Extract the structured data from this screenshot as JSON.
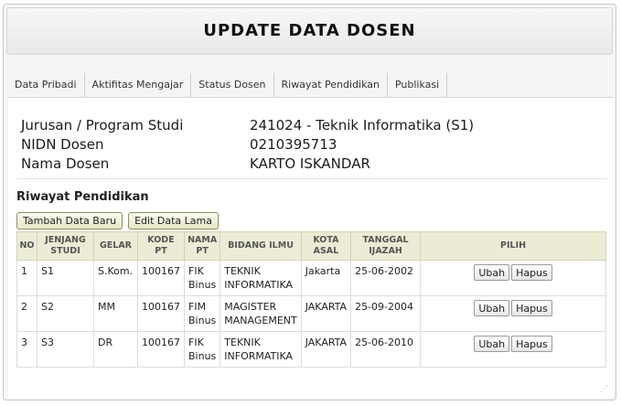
{
  "title": "UPDATE DATA DOSEN",
  "tabs": [
    {
      "label": "Data Pribadi"
    },
    {
      "label": "Aktifitas Mengajar"
    },
    {
      "label": "Status Dosen"
    },
    {
      "label": "Riwayat Pendidikan"
    },
    {
      "label": "Publikasi"
    }
  ],
  "info": [
    {
      "label": "Jurusan / Program Studi",
      "value": "241024 - Teknik Informatika (S1)"
    },
    {
      "label": "NIDN Dosen",
      "value": "0210395713"
    },
    {
      "label": "Nama Dosen",
      "value": "KARTO ISKANDAR"
    }
  ],
  "section": {
    "title": "Riwayat Pendidikan",
    "add_label": "Tambah Data Baru",
    "edit_label": "Edit Data Lama"
  },
  "table": {
    "headers": [
      "NO",
      "JENJANG STUDI",
      "GELAR",
      "KODE PT",
      "NAMA PT",
      "BIDANG ILMU",
      "KOTA ASAL",
      "TANGGAL IJAZAH",
      "PILIH"
    ],
    "rows": [
      {
        "no": "1",
        "jenjang": "S1",
        "gelar": "S.Kom.",
        "kode_pt": "100167",
        "nama_pt": "FIK Binus",
        "bidang": "TEKNIK INFORMATIKA",
        "kota": "Jakarta",
        "tanggal": "25-06-2002"
      },
      {
        "no": "2",
        "jenjang": "S2",
        "gelar": "MM",
        "kode_pt": "100167",
        "nama_pt": "FIM Binus",
        "bidang": "MAGISTER MANAGEMENT",
        "kota": "JAKARTA",
        "tanggal": "25-09-2004"
      },
      {
        "no": "3",
        "jenjang": "S3",
        "gelar": "DR",
        "kode_pt": "100167",
        "nama_pt": "FIK Binus",
        "bidang": "TEKNIK INFORMATIKA",
        "kota": "JAKARTA",
        "tanggal": "25-06-2010"
      }
    ],
    "ubah_label": "Ubah",
    "hapus_label": "Hapus"
  },
  "resize_grip_icon": "resize-grip-icon"
}
